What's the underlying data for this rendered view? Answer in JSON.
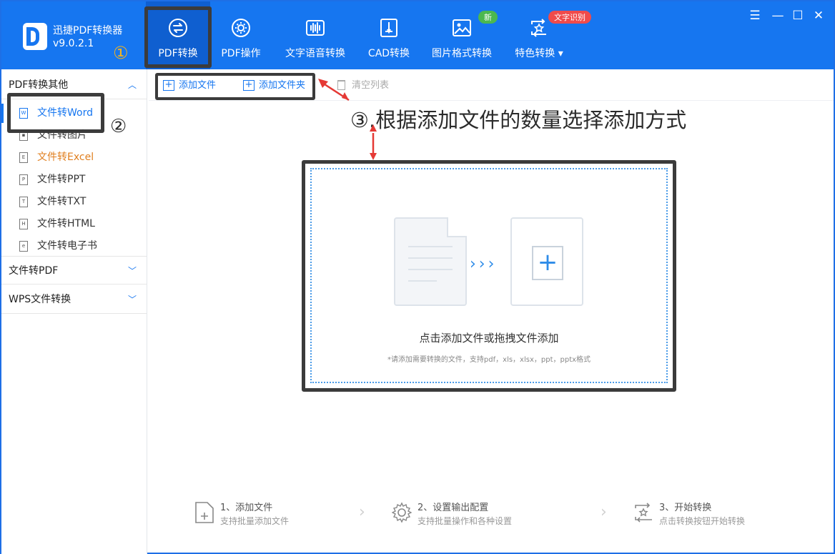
{
  "app": {
    "title": "迅捷PDF转换器",
    "version": "v9.0.2.1"
  },
  "tabs": [
    {
      "label": "PDF转换",
      "icon": "swap-icon"
    },
    {
      "label": "PDF操作",
      "icon": "gear-icon"
    },
    {
      "label": "文字语音转换",
      "icon": "waveform-icon"
    },
    {
      "label": "CAD转换",
      "icon": "cad-icon"
    },
    {
      "label": "图片格式转换",
      "icon": "image-icon"
    },
    {
      "label": "特色转换",
      "icon": "star-swap-icon"
    }
  ],
  "badges": {
    "new": "新",
    "ocr": "文字识别"
  },
  "markers": {
    "one": "①",
    "two": "②"
  },
  "window_controls": {
    "menu": "☰",
    "minimize": "—",
    "maximize": "☐",
    "close": "✕"
  },
  "sidebar": {
    "section1": "PDF转换其他",
    "items": [
      {
        "label": "文件转Word",
        "icon": "W"
      },
      {
        "label": "文件转图片",
        "icon": "▪"
      },
      {
        "label": "文件转Excel",
        "icon": "E"
      },
      {
        "label": "文件转PPT",
        "icon": "P"
      },
      {
        "label": "文件转TXT",
        "icon": "T"
      },
      {
        "label": "文件转HTML",
        "icon": "H"
      },
      {
        "label": "文件转电子书",
        "icon": "e"
      }
    ],
    "section2": "文件转PDF",
    "section3": "WPS文件转换"
  },
  "toolbar": {
    "add_file": "添加文件",
    "add_folder": "添加文件夹",
    "clear_list": "清空列表"
  },
  "annotation": "③.根据添加文件的数量选择添加方式",
  "dropzone": {
    "main": "点击添加文件或拖拽文件添加",
    "sub": "*请添加需要转换的文件，支持pdf，xls，xlsx，ppt，pptx格式",
    "arrows": "›››"
  },
  "steps": [
    {
      "title": "1、添加文件",
      "sub": "支持批量添加文件"
    },
    {
      "title": "2、设置输出配置",
      "sub": "支持批量操作和各种设置"
    },
    {
      "title": "3、开始转换",
      "sub": "点击转换按钮开始转换"
    }
  ],
  "colors": {
    "brand": "#1676f0",
    "annotation_border": "#3b3b3b",
    "marker": "#f2b320",
    "arrow": "#e53935"
  }
}
